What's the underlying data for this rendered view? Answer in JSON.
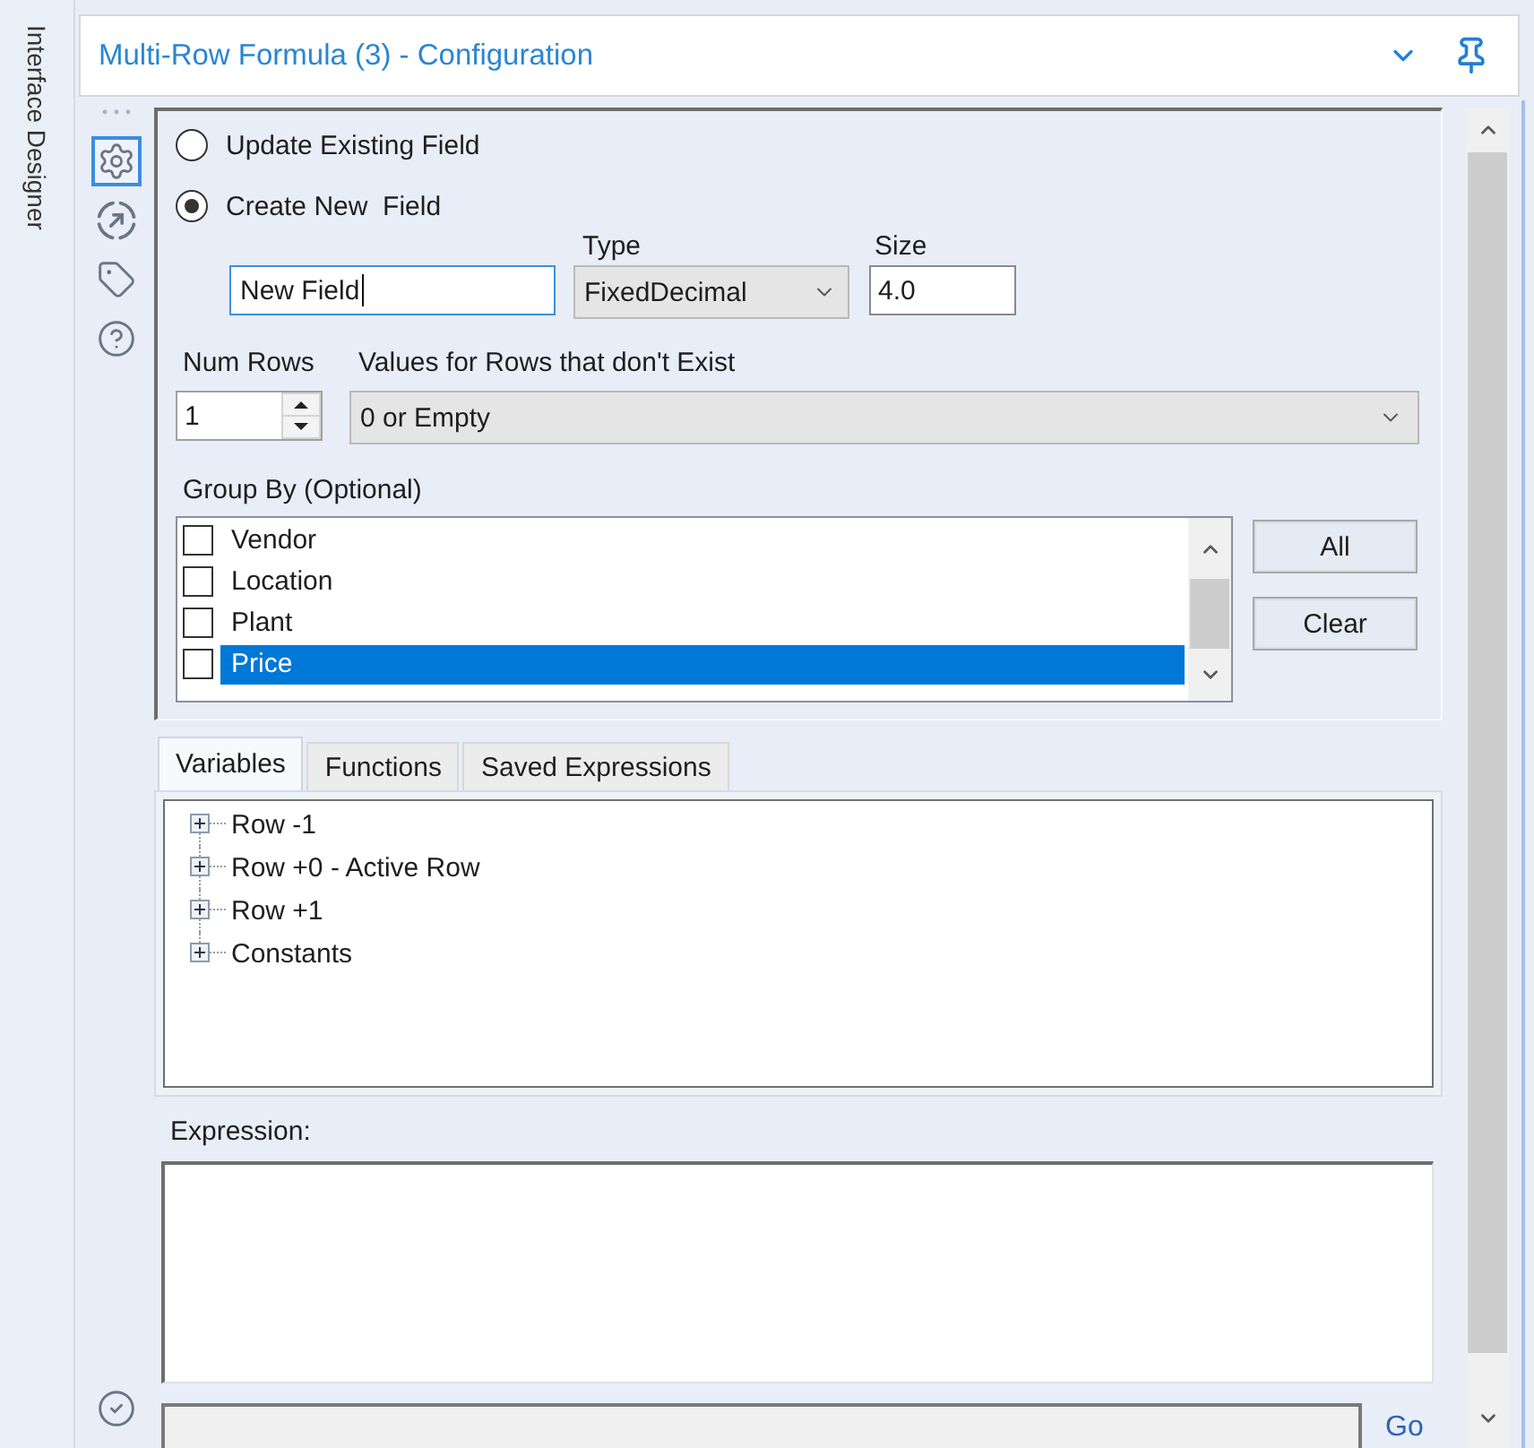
{
  "side_panel": {
    "label": "Interface Designer"
  },
  "header": {
    "title": "Multi-Row Formula (3) - Configuration"
  },
  "nav_tabs": [
    {
      "selected": true
    },
    {
      "selected": false
    },
    {
      "selected": false
    },
    {
      "selected": false
    }
  ],
  "field_mode": [
    {
      "label": "Update Existing Field",
      "selected": false
    },
    {
      "label": "Create New  Field",
      "selected": true
    }
  ],
  "new_field": {
    "value": "New Field",
    "focused": true
  },
  "type": {
    "label": "Type",
    "value": "FixedDecimal"
  },
  "size": {
    "label": "Size",
    "value": "4.0"
  },
  "num_rows": {
    "label": "Num Rows",
    "value": "1"
  },
  "missing_rows": {
    "label": "Values for Rows that don't Exist",
    "value": "0 or Empty"
  },
  "group_by": {
    "label": "Group By (Optional)",
    "items": [
      {
        "label": "Vendor",
        "checked": false,
        "selected": false
      },
      {
        "label": "Location",
        "checked": false,
        "selected": false
      },
      {
        "label": "Plant",
        "checked": false,
        "selected": false
      },
      {
        "label": "Price",
        "checked": false,
        "selected": true
      }
    ],
    "buttons": [
      "All",
      "Clear"
    ]
  },
  "expression_tabs": [
    {
      "label": "Variables",
      "selected": true
    },
    {
      "label": "Functions",
      "selected": false
    },
    {
      "label": "Saved Expressions",
      "selected": false
    }
  ],
  "variables_tree": [
    {
      "label": "Row -1",
      "expanded": false
    },
    {
      "label": "Row +0 - Active Row",
      "expanded": false
    },
    {
      "label": "Row +1",
      "expanded": false
    },
    {
      "label": "Constants",
      "expanded": false
    }
  ],
  "expression": {
    "label": "Expression:"
  },
  "footer": {
    "link": "Go"
  }
}
